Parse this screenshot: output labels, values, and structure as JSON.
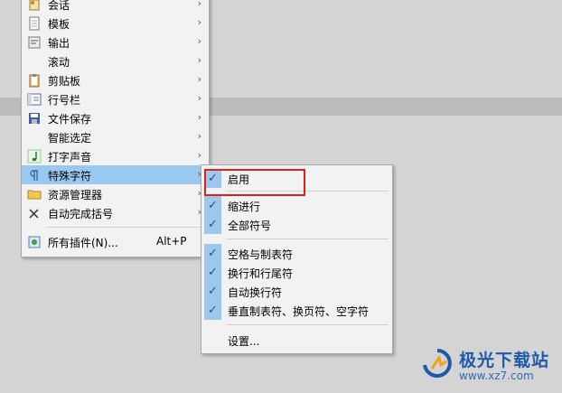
{
  "main_menu": {
    "items": [
      {
        "label": "会话",
        "icon": "session-icon",
        "has_submenu": true
      },
      {
        "label": "模板",
        "icon": "template-icon",
        "has_submenu": true
      },
      {
        "label": "输出",
        "icon": "output-icon",
        "has_submenu": true
      },
      {
        "label": "滚动",
        "icon": "",
        "has_submenu": true
      },
      {
        "label": "剪贴板",
        "icon": "clipboard-icon",
        "has_submenu": true
      },
      {
        "label": "行号栏",
        "icon": "line-number-icon",
        "has_submenu": true
      },
      {
        "label": "文件保存",
        "icon": "save-icon",
        "has_submenu": true
      },
      {
        "label": "智能选定",
        "icon": "",
        "has_submenu": true
      },
      {
        "label": "打字声音",
        "icon": "music-note-icon",
        "has_submenu": true
      },
      {
        "label": "特殊字符",
        "icon": "pilcrow-icon",
        "has_submenu": true,
        "highlighted": true
      },
      {
        "label": "资源管理器",
        "icon": "folder-icon",
        "has_submenu": true
      },
      {
        "label": "自动完成括号",
        "icon": "close-bracket-icon",
        "has_submenu": true
      }
    ],
    "all_plugins": {
      "label": "所有插件(N)...",
      "shortcut": "Alt+P",
      "icon": "plugin-icon"
    },
    "arrow_glyph": "›"
  },
  "sub_menu": {
    "items": [
      {
        "label": "启用",
        "checked": true
      },
      {
        "label": "缩进行",
        "checked": true
      },
      {
        "label": "全部符号",
        "checked": true
      },
      {
        "label": "空格与制表符",
        "checked": true
      },
      {
        "label": "换行和行尾符",
        "checked": true
      },
      {
        "label": "自动换行符",
        "checked": true
      },
      {
        "label": "垂直制表符、换页符、空字符",
        "checked": true
      },
      {
        "label": "设置...",
        "checked": false
      }
    ],
    "check_glyph": "✓"
  },
  "watermark": {
    "title": "极光下载站",
    "url": "www.xz7.com"
  },
  "colors": {
    "highlight": "#99c9ef",
    "check_bg": "#9ec7ec",
    "annotation": "#e02020",
    "watermark": "#1e5aa8"
  }
}
